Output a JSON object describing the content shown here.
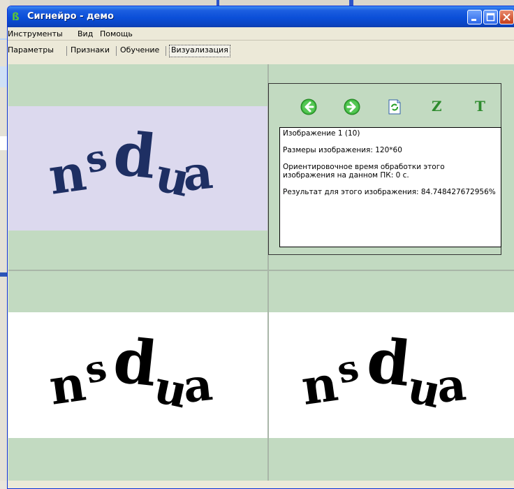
{
  "window": {
    "title": "Сигнейро - демо"
  },
  "menu": {
    "items": [
      "Инструменты",
      "Вид",
      "Помощь"
    ]
  },
  "tabs": {
    "items": [
      "Параметры",
      "Признаки",
      "Обучение",
      "Визуализация"
    ],
    "active": "Визуализация"
  },
  "captcha": {
    "text": "nsdua"
  },
  "toolbar": {
    "z_label": "Z",
    "t_label": "T"
  },
  "info": {
    "line1": "Изображение 1 (10)",
    "line2": "Размеры изображения: 120*60",
    "line3": "Ориентировочное время обработки этого изображения на данном ПК: 0 с.",
    "line4": "Результат для этого изображения: 84.748427672956%"
  },
  "colors": {
    "panel_green": "#c2dac1",
    "captcha_bg": "#dcd9ee",
    "captcha_ink": "#1e2f63"
  }
}
